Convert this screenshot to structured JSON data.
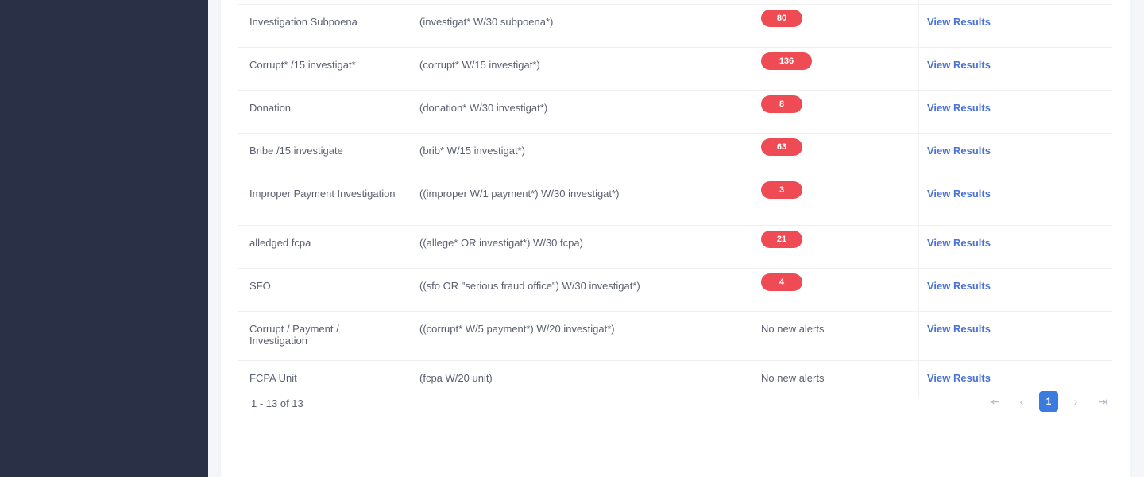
{
  "table": {
    "rows": [
      {
        "name": "",
        "query": "",
        "alerts": "",
        "alerts_type": "badge",
        "action": ""
      },
      {
        "name": "Investigation Subpoena",
        "query": "(investigat* W/30 subpoena*)",
        "alerts": "80",
        "alerts_type": "badge",
        "action": "View Results"
      },
      {
        "name": "Corrupt* /15 investigat*",
        "query": "(corrupt* W/15 investigat*)",
        "alerts": "136",
        "alerts_type": "badge",
        "action": "View Results"
      },
      {
        "name": "Donation",
        "query": "(donation* W/30 investigat*)",
        "alerts": "8",
        "alerts_type": "badge",
        "action": "View Results"
      },
      {
        "name": "Bribe /15 investigate",
        "query": "(brib* W/15 investigat*)",
        "alerts": "63",
        "alerts_type": "badge",
        "action": "View Results"
      },
      {
        "name": "Improper Payment Investigation",
        "query": "((improper W/1 payment*) W/30 investigat*)",
        "alerts": "3",
        "alerts_type": "badge",
        "action": "View Results"
      },
      {
        "name": "alledged fcpa",
        "query": "((allege* OR investigat*) W/30 fcpa)",
        "alerts": "21",
        "alerts_type": "badge",
        "action": "View Results"
      },
      {
        "name": "SFO",
        "query": "((sfo OR \"serious fraud office\") W/30 investigat*)",
        "alerts": "4",
        "alerts_type": "badge",
        "action": "View Results"
      },
      {
        "name": "Corrupt / Payment / Investigation",
        "query": "((corrupt* W/5 payment*) W/20 investigat*)",
        "alerts": "No new alerts",
        "alerts_type": "text",
        "action": "View Results"
      },
      {
        "name": "FCPA Unit",
        "query": "(fcpa W/20 unit)",
        "alerts": "No new alerts",
        "alerts_type": "text",
        "action": "View Results"
      }
    ]
  },
  "footer": {
    "range": "1 - 13 of 13",
    "current_page": "1",
    "first_icon": "first-page-icon",
    "prev_icon": "prev-page-icon",
    "next_icon": "next-page-icon",
    "last_icon": "last-page-icon"
  },
  "colors": {
    "sidebar": "#2a3045",
    "badge": "#ef4b55",
    "link": "#4a73d8",
    "active_page": "#3b7be0"
  }
}
